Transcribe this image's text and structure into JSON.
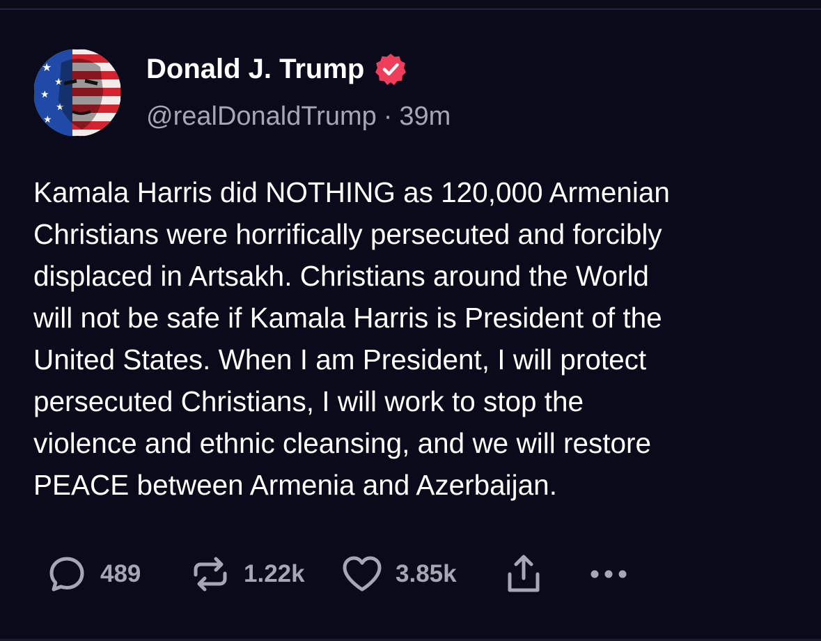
{
  "post": {
    "author": {
      "display_name": "Donald J. Trump",
      "handle": "@realDonaldTrump",
      "separator": "·",
      "time_ago": "39m",
      "verified_badge_color": "#ef3d5c",
      "avatar_icon": "flag-face-avatar"
    },
    "body": "Kamala Harris did NOTHING as 120,000 Armenian\nChristians were horrifically persecuted and forcibly\ndisplaced in Artsakh. Christians around the World\nwill not be safe if Kamala Harris is President of the\nUnited States. When I am President, I will protect\npersecuted Christians, I will work to stop the\nviolence and ethnic cleansing, and we will restore\nPEACE between Armenia and Azerbaijan.",
    "actions": {
      "reply": {
        "icon": "reply-bubble-icon",
        "count": "489"
      },
      "repost": {
        "icon": "repost-icon",
        "count": "1.22k"
      },
      "like": {
        "icon": "heart-icon",
        "count": "3.85k"
      },
      "share": {
        "icon": "share-icon"
      },
      "more": {
        "icon": "more-dots-icon"
      }
    }
  },
  "colors": {
    "background": "#0b0a1a",
    "text_primary": "#ffffff",
    "text_secondary": "#a7a6b6"
  }
}
